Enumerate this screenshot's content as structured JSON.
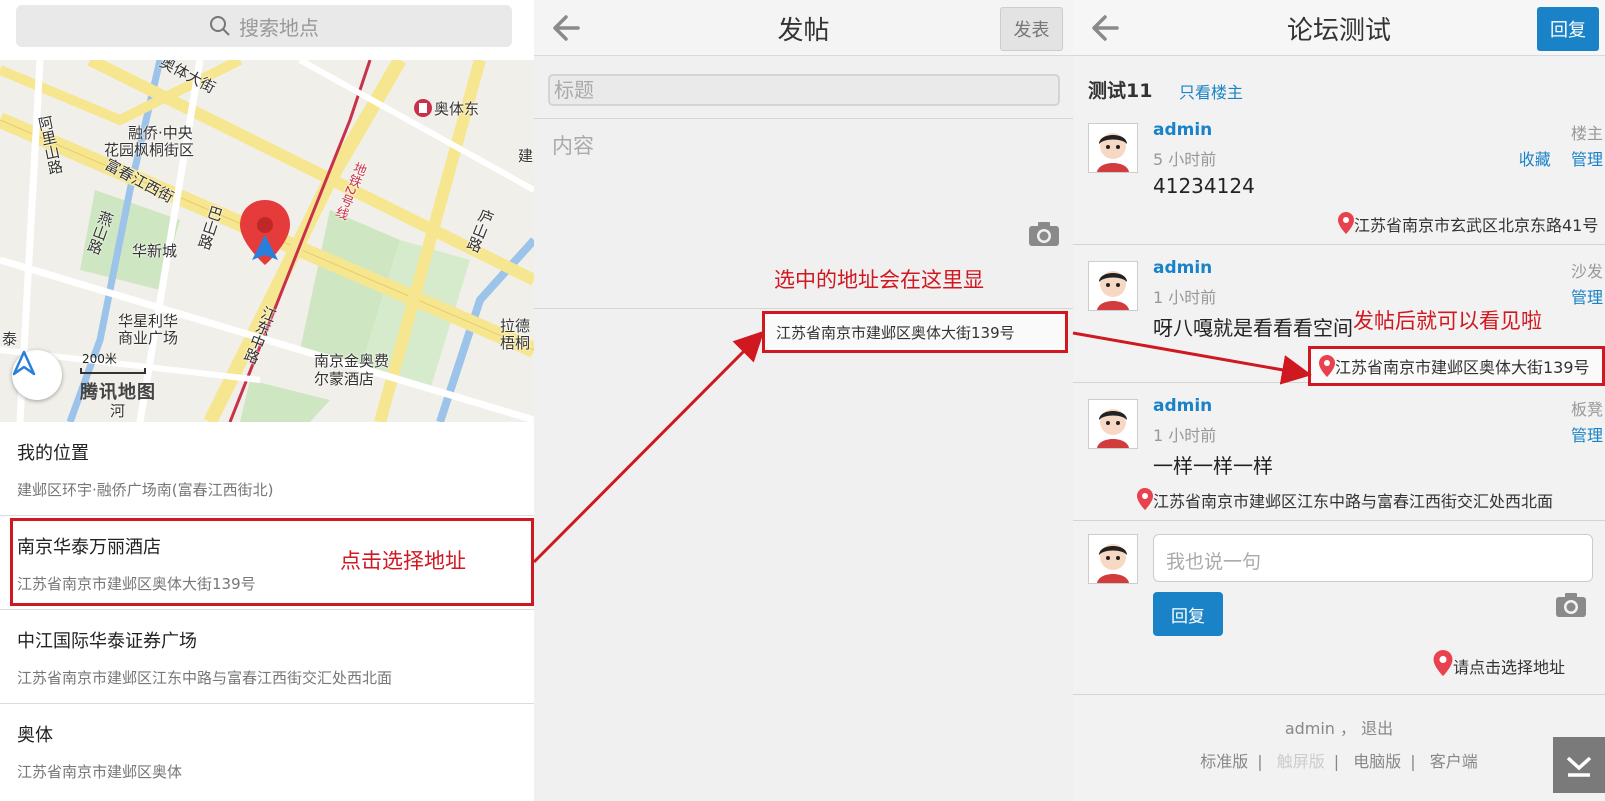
{
  "map_panel": {
    "search_placeholder": "搜索地点",
    "labels": {
      "street_1": "奥体大街",
      "metro_station": "奥体东",
      "road_2": "阿里山路",
      "community_1": "融侨·中央",
      "community_2": "花园枫桐街区",
      "street_3": "富春江西街",
      "road_4": "燕山路",
      "community_3": "华新城",
      "road_5": "巴山路",
      "metro_line": "地铁2号线",
      "road_6": "庐山路",
      "plaza_1": "华星利华",
      "plaza_2": "商业广场",
      "road_7": "江东中路",
      "hotel_1": "南京金奥费",
      "hotel_2": "尔蒙酒店",
      "place_1": "拉德",
      "place_2": "梧桐",
      "place_3": "建",
      "place_4": "泰",
      "place_5": "河"
    },
    "scale": "200米",
    "brand": "腾讯地图",
    "poi": [
      {
        "name": "我的位置",
        "addr": "建邺区环宇·融侨广场南(富春江西街北)"
      },
      {
        "name": "南京华泰万丽酒店",
        "addr": "江苏省南京市建邺区奥体大街139号"
      },
      {
        "name": "中江国际华泰证券广场",
        "addr": "江苏省南京市建邺区江东中路与富春江西街交汇处西北面"
      },
      {
        "name": "奥体",
        "addr": "江苏省南京市建邺区奥体"
      }
    ],
    "annotation": "点击选择地址"
  },
  "post_panel": {
    "title": "发帖",
    "publish_label": "发表",
    "title_placeholder": "标题",
    "content_placeholder": "内容",
    "selected_addr": "江苏省南京市建邺区奥体大街139号",
    "annotation": "选中的地址会在这里显"
  },
  "thread_panel": {
    "title": "论坛测试",
    "reply_label": "回复",
    "thread_title": "测试11",
    "only_op": "只看楼主",
    "posts": [
      {
        "author": "admin",
        "time": "5 小时前",
        "floor": "楼主",
        "body": "41234124",
        "fav": "收藏",
        "manage": "管理",
        "location": "江苏省南京市玄武区北京东路41号"
      },
      {
        "author": "admin",
        "time": "1 小时前",
        "floor": "沙发",
        "body": "呀八嘎就是看看看空间",
        "manage": "管理",
        "location": "江苏省南京市建邺区奥体大街139号"
      },
      {
        "author": "admin",
        "time": "1 小时前",
        "floor": "板凳",
        "body": "一样一样一样",
        "manage": "管理",
        "location": "江苏省南京市建邺区江东中路与富春江西街交汇处西北面"
      }
    ],
    "reply_placeholder": "我也说一句",
    "reply_button": "回复",
    "choose_addr": "请点击选择地址",
    "footer_user": "admin",
    "footer_sep": "，",
    "footer_logout": "退出",
    "footer_links": [
      "标准版",
      "触屏版",
      "电脑版",
      "客户端"
    ],
    "annotation": "发帖后就可以看见啦"
  },
  "colors": {
    "accent_blue": "#1a83c8",
    "annotation_red": "#d01820",
    "pin_red": "#e8424f"
  }
}
